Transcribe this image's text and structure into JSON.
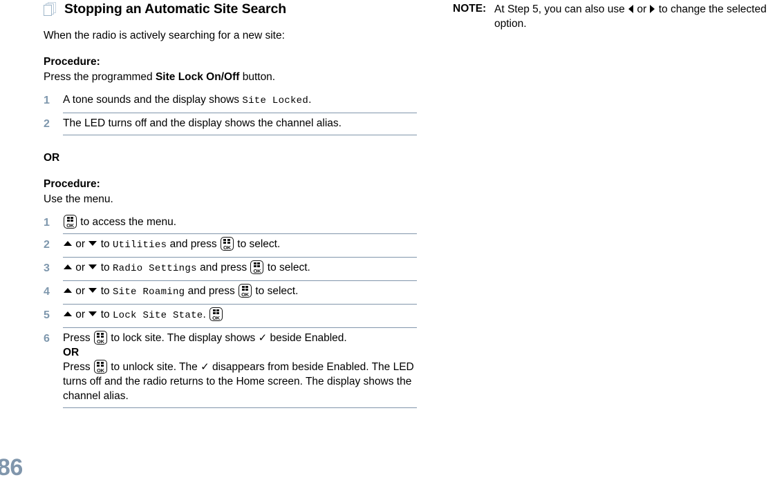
{
  "page": {
    "folio": "86"
  },
  "heading": {
    "icon": "stacked-pages-icon",
    "title": "Stopping an Automatic Site Search"
  },
  "intro": {
    "text": "When the radio is actively searching for a new site:"
  },
  "procedure_1": {
    "label": "Procedure:",
    "lead_before": "Press the programmed ",
    "lead_bold": "Site Lock On/Off",
    "lead_after": " button.",
    "steps": [
      {
        "num": "1",
        "before": "A tone sounds and the display shows ",
        "mono": "Site Locked",
        "after": "."
      },
      {
        "num": "2",
        "before": "The LED turns off and the display shows the channel alias.",
        "mono": "",
        "after": ""
      }
    ]
  },
  "or_divider": {
    "label": "OR"
  },
  "procedure_2": {
    "label": "Procedure:",
    "lead": "Use the menu.",
    "steps": [
      {
        "num": "1",
        "p1": "",
        "key": "menu-ok-key",
        "p2": " to access the menu.",
        "mono": "",
        "p3": ""
      },
      {
        "num": "2",
        "p1": " or ",
        "p2": " to ",
        "mono": "Utilities",
        "p3": " and press ",
        "p4": " to select."
      },
      {
        "num": "3",
        "p1": " or ",
        "p2": " to ",
        "mono": "Radio Settings",
        "p3": " and press ",
        "p4": " to select."
      },
      {
        "num": "4",
        "p1": " or ",
        "p2": " to ",
        "mono": "Site Roaming",
        "p3": " and press ",
        "p4": " to select."
      },
      {
        "num": "5",
        "p1": " or ",
        "p2": " to ",
        "mono": "Lock Site State",
        "p3": ". ",
        "p4": ""
      }
    ],
    "step6": {
      "num": "6",
      "line1_before": "Press ",
      "line1_after": " to lock site. The display shows ",
      "line1_check": "✓",
      "line1_tail": " beside Enabled.",
      "or": "OR",
      "line2_before": "Press ",
      "line2_after": " to unlock site. The ",
      "line2_check": "✓",
      "line2_tail": " disappears from beside Enabled. The LED turns off and the radio returns to the Home screen. The display shows the channel alias."
    }
  },
  "note": {
    "label": "NOTE:",
    "before": "At Step 5, you can also use ",
    "middle": " or ",
    "after": " to change the selected option."
  },
  "colors": {
    "rule": "#8095ab",
    "step_number": "#7e97ad",
    "folio": "#8096ac",
    "icon_outline": "#a9bed0"
  }
}
